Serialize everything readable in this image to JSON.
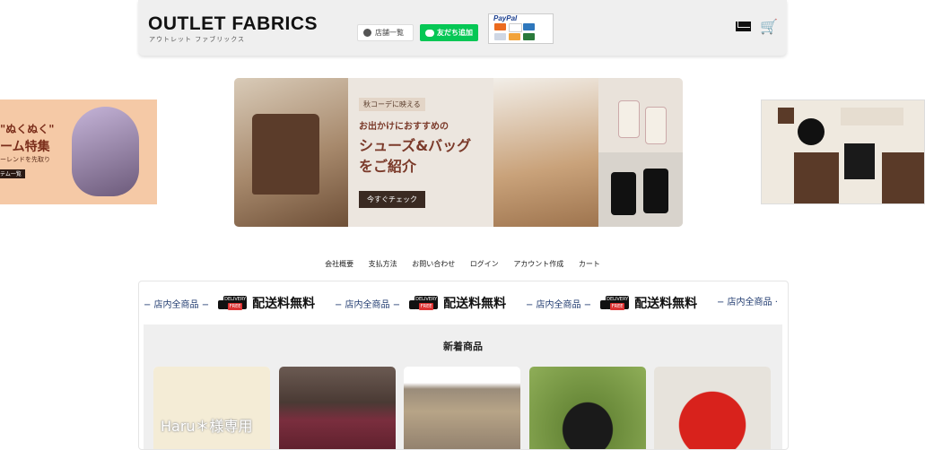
{
  "header": {
    "logo_title": "OUTLET FABRICS",
    "logo_sub": "アウトレット ファブリックス",
    "shop_list_label": "店舗一覧",
    "line_add_label": "友だち追加",
    "paypal_label": "PayPal",
    "icons": [
      "mail-icon",
      "cart-icon"
    ]
  },
  "banner": {
    "tag": "秋コーデに映える",
    "line1": "お出かけにおすすめの",
    "line2": "シューズ&バッグ",
    "line3": "をご紹介",
    "cta": "今すぐチェック",
    "left_line1": "\"ぬくぬく\"",
    "left_line2": "ーム特集",
    "left_line3": "ーレンドを先取り",
    "left_pill": "テム一覧"
  },
  "nav": {
    "items": [
      "会社概要",
      "支払方法",
      "お問い合わせ",
      "ログイン",
      "アカウント作成",
      "カート"
    ]
  },
  "ticker": {
    "store_text": "− 店内全商品 −",
    "free_text": "配送料無料",
    "badge_top": "DELIVERY",
    "badge_free": "FREE",
    "tail_text": "− 店内全商品 ·"
  },
  "new_items": {
    "title": "新着商品",
    "first_card_text": "Haru＊様専用"
  },
  "colors": {
    "header_bg": "#efefef",
    "line_green": "#06c755",
    "ticker_blue": "#1f3a6f",
    "banner_brown": "#7b3a2a"
  }
}
